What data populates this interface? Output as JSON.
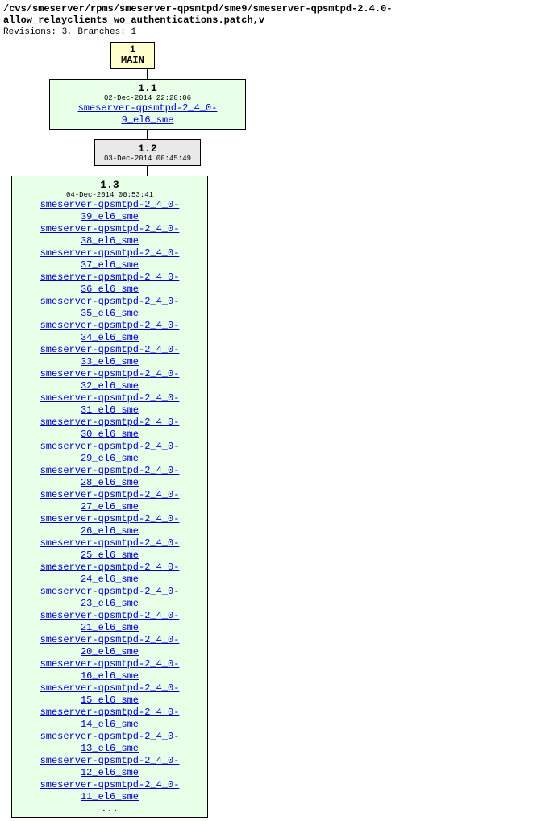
{
  "header": {
    "path": "/cvs/smeserver/rpms/smeserver-qpsmtpd/sme9/smeserver-qpsmtpd-2.4.0-allow_relayclients_wo_authentications.patch,v",
    "meta": "Revisions: 3, Branches: 1"
  },
  "root": {
    "num": "1",
    "label": "MAIN"
  },
  "revisions": [
    {
      "rev": "1.1",
      "date": "02-Dec-2014 22:28:06",
      "tags": [
        "smeserver-qpsmtpd-2_4_0-9_el6_sme"
      ],
      "bg": "box-11"
    },
    {
      "rev": "1.2",
      "date": "03-Dec-2014 00:45:49",
      "tags": [],
      "bg": "box-12"
    },
    {
      "rev": "1.3",
      "date": "04-Dec-2014 00:53:41",
      "tags": [
        "smeserver-qpsmtpd-2_4_0-39_el6_sme",
        "smeserver-qpsmtpd-2_4_0-38_el6_sme",
        "smeserver-qpsmtpd-2_4_0-37_el6_sme",
        "smeserver-qpsmtpd-2_4_0-36_el6_sme",
        "smeserver-qpsmtpd-2_4_0-35_el6_sme",
        "smeserver-qpsmtpd-2_4_0-34_el6_sme",
        "smeserver-qpsmtpd-2_4_0-33_el6_sme",
        "smeserver-qpsmtpd-2_4_0-32_el6_sme",
        "smeserver-qpsmtpd-2_4_0-31_el6_sme",
        "smeserver-qpsmtpd-2_4_0-30_el6_sme",
        "smeserver-qpsmtpd-2_4_0-29_el6_sme",
        "smeserver-qpsmtpd-2_4_0-28_el6_sme",
        "smeserver-qpsmtpd-2_4_0-27_el6_sme",
        "smeserver-qpsmtpd-2_4_0-26_el6_sme",
        "smeserver-qpsmtpd-2_4_0-25_el6_sme",
        "smeserver-qpsmtpd-2_4_0-24_el6_sme",
        "smeserver-qpsmtpd-2_4_0-23_el6_sme",
        "smeserver-qpsmtpd-2_4_0-21_el6_sme",
        "smeserver-qpsmtpd-2_4_0-20_el6_sme",
        "smeserver-qpsmtpd-2_4_0-16_el6_sme",
        "smeserver-qpsmtpd-2_4_0-15_el6_sme",
        "smeserver-qpsmtpd-2_4_0-14_el6_sme",
        "smeserver-qpsmtpd-2_4_0-13_el6_sme",
        "smeserver-qpsmtpd-2_4_0-12_el6_sme",
        "smeserver-qpsmtpd-2_4_0-11_el6_sme"
      ],
      "ellipsis": "...",
      "bg": "box-13"
    }
  ]
}
